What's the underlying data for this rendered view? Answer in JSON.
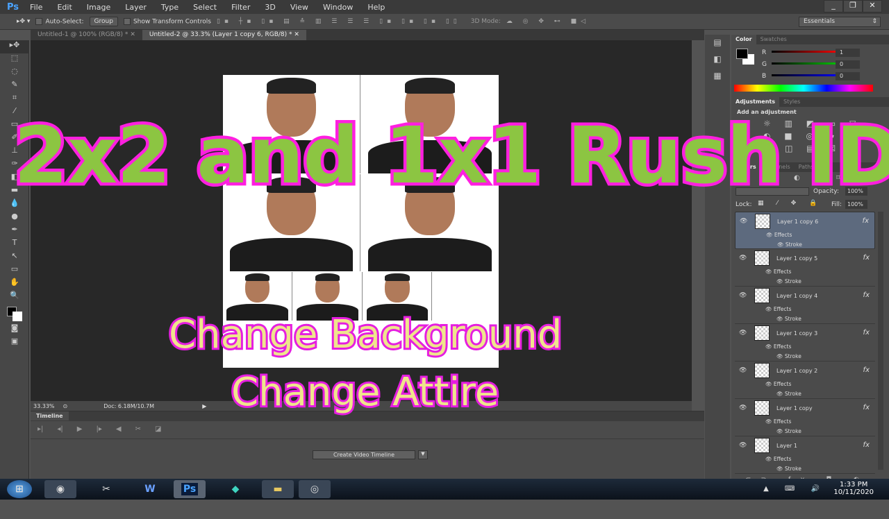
{
  "app": {
    "logo": "Ps",
    "menu": [
      "File",
      "Edit",
      "Image",
      "Layer",
      "Type",
      "Select",
      "Filter",
      "3D",
      "View",
      "Window",
      "Help"
    ]
  },
  "options": {
    "auto_select": "Auto-Select:",
    "group": "Group",
    "show_transform": "Show Transform Controls",
    "mode3d": "3D Mode:",
    "workspace": "Essentials"
  },
  "tabs": [
    {
      "label": "Untitled-1 @ 100% (RGB/8) *"
    },
    {
      "label": "Untitled-2 @ 33.3% (Layer 1 copy 6, RGB/8) *"
    }
  ],
  "status": {
    "zoom": "33.33%",
    "doc": "Doc: 6.18M/10.7M"
  },
  "timeline": {
    "tab": "Timeline",
    "create": "Create Video Timeline"
  },
  "color_panel": {
    "tabs": [
      "Color",
      "Swatches"
    ],
    "r": "1",
    "g": "0",
    "b": "0",
    "labels": [
      "R",
      "G",
      "B"
    ]
  },
  "adjustments": {
    "tabs": [
      "Adjustments",
      "Styles"
    ],
    "heading": "Add an adjustment"
  },
  "layers_panel": {
    "tabs": [
      "Layers",
      "Channels",
      "Paths"
    ],
    "opacity_label": "Opacity:",
    "opacity": "100%",
    "lock_label": "Lock:",
    "fill_label": "Fill:",
    "fill": "100%",
    "layers": [
      {
        "name": "Layer 1 copy 6",
        "effects": "Effects",
        "stroke": "Stroke"
      },
      {
        "name": "Layer 1 copy 5",
        "effects": "Effects",
        "stroke": "Stroke"
      },
      {
        "name": "Layer 1 copy 4",
        "effects": "Effects",
        "stroke": "Stroke"
      },
      {
        "name": "Layer 1 copy 3",
        "effects": "Effects",
        "stroke": "Stroke"
      },
      {
        "name": "Layer 1 copy 2",
        "effects": "Effects",
        "stroke": "Stroke"
      },
      {
        "name": "Layer 1 copy",
        "effects": "Effects",
        "stroke": "Stroke"
      },
      {
        "name": "Layer 1",
        "effects": "Effects",
        "stroke": "Stroke"
      }
    ]
  },
  "overlay": {
    "title": "2x2 and 1x1 Rush ID",
    "line1": "Change Background",
    "line2": "Change Attire"
  },
  "taskbar": {
    "ps": "Ps",
    "time": "1:33 PM",
    "date": "10/11/2020"
  },
  "colors": {
    "title_fill": "#8cc542",
    "title_stroke": "#ff1fe0",
    "sub_fill": "#efe58c",
    "sub_stroke": "#e51ee0"
  }
}
